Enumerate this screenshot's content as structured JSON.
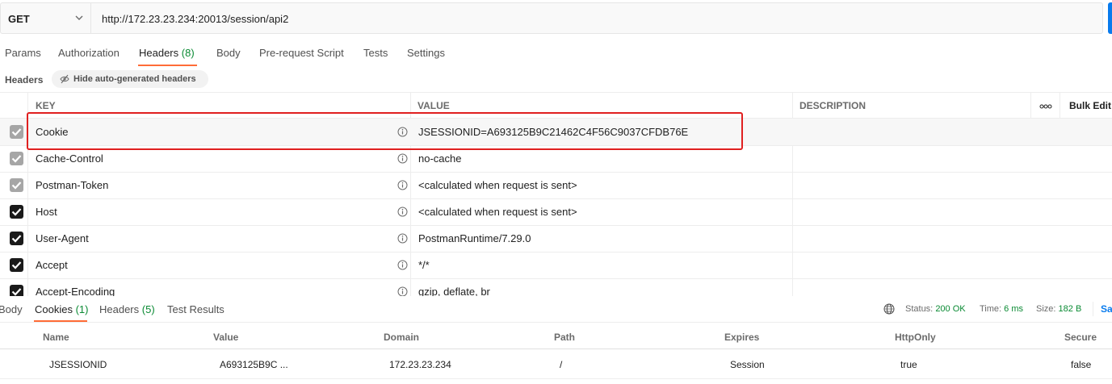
{
  "request": {
    "method": "GET",
    "url": "http://172.23.23.234:20013/session/api2"
  },
  "request_tabs": [
    {
      "label": "Params",
      "count": ""
    },
    {
      "label": "Authorization",
      "count": ""
    },
    {
      "label": "Headers",
      "count": "(8)"
    },
    {
      "label": "Body",
      "count": ""
    },
    {
      "label": "Pre-request Script",
      "count": ""
    },
    {
      "label": "Tests",
      "count": ""
    },
    {
      "label": "Settings",
      "count": ""
    }
  ],
  "headers_section": {
    "label": "Headers",
    "hide_auto_label": "Hide auto-generated headers"
  },
  "headers_table": {
    "columns": {
      "key": "KEY",
      "value": "VALUE",
      "description": "DESCRIPTION",
      "bulk_edit": "Bulk Edit"
    },
    "rows": [
      {
        "key": "Cookie",
        "value": "JSESSIONID=A693125B9C21462C4F56C9037CFDB76E",
        "checked": "dim"
      },
      {
        "key": "Cache-Control",
        "value": "no-cache",
        "checked": "dim"
      },
      {
        "key": "Postman-Token",
        "value": "<calculated when request is sent>",
        "checked": "dim"
      },
      {
        "key": "Host",
        "value": "<calculated when request is sent>",
        "checked": "on"
      },
      {
        "key": "User-Agent",
        "value": "PostmanRuntime/7.29.0",
        "checked": "on"
      },
      {
        "key": "Accept",
        "value": "*/*",
        "checked": "on"
      },
      {
        "key": "Accept-Encoding",
        "value": "gzip, deflate, br",
        "checked": "on"
      }
    ]
  },
  "response_tabs": [
    {
      "label": "Body",
      "count": ""
    },
    {
      "label": "Cookies",
      "count": "(1)"
    },
    {
      "label": "Headers",
      "count": "(5)"
    },
    {
      "label": "Test Results",
      "count": ""
    }
  ],
  "response_meta": {
    "status_label": "Status:",
    "status_value": "200 OK",
    "time_label": "Time:",
    "time_value": "6 ms",
    "size_label": "Size:",
    "size_value": "182 B",
    "save_label": "Sa"
  },
  "cookies_table": {
    "columns": [
      "Name",
      "Value",
      "Domain",
      "Path",
      "Expires",
      "HttpOnly",
      "Secure"
    ],
    "row": [
      "JSESSIONID",
      "A693125B9C ...",
      "172.23.23.234",
      "/",
      "Session",
      "true",
      "false"
    ]
  },
  "colors": {
    "accent_orange": "#ff6c37",
    "status_green": "#0a8a33",
    "highlight_red": "#e02020",
    "link_blue": "#097bed"
  },
  "icons": [
    "chevron-down-icon",
    "eye-off-icon",
    "info-icon",
    "checkbox-icon",
    "more-dots-icon",
    "globe-icon"
  ]
}
